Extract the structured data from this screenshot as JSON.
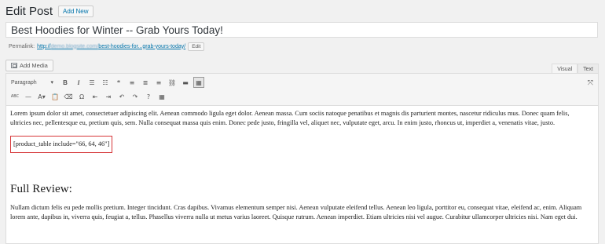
{
  "header": {
    "title": "Edit Post",
    "add_new_label": "Add New"
  },
  "post_title": {
    "value": "Best Hoodies for Winter -- Grab Yours Today!",
    "placeholder": "Enter title here"
  },
  "permalink": {
    "label": "Permalink:",
    "domain_prefix": "http://",
    "domain_blurred": "demo.blogsite.com/",
    "slug": "best-hoodies-for...grab-yours-today/",
    "edit_label": "Edit"
  },
  "media": {
    "add_media_label": "Add Media"
  },
  "tabs": {
    "visual": "Visual",
    "text": "Text"
  },
  "toolbar": {
    "format_value": "Paragraph",
    "row1": [
      {
        "name": "bold-button",
        "glyph": "B",
        "cls": "b"
      },
      {
        "name": "italic-button",
        "glyph": "I",
        "cls": "i"
      },
      {
        "name": "bulleted-list-button",
        "glyph": "☰",
        "cls": ""
      },
      {
        "name": "numbered-list-button",
        "glyph": "☷",
        "cls": ""
      },
      {
        "name": "blockquote-button",
        "glyph": "❝",
        "cls": ""
      },
      {
        "name": "align-left-button",
        "glyph": "≡",
        "cls": ""
      },
      {
        "name": "align-center-button",
        "glyph": "≣",
        "cls": ""
      },
      {
        "name": "align-right-button",
        "glyph": "≡",
        "cls": ""
      },
      {
        "name": "insert-link-button",
        "glyph": "⛓",
        "cls": ""
      },
      {
        "name": "read-more-button",
        "glyph": "▬",
        "cls": ""
      },
      {
        "name": "toolbar-toggle-button",
        "glyph": "▦",
        "cls": "active"
      }
    ],
    "row2": [
      {
        "name": "strikethrough-button",
        "glyph": "ABC",
        "cls": "small"
      },
      {
        "name": "horizontal-line-button",
        "glyph": "—",
        "cls": ""
      },
      {
        "name": "text-color-button",
        "glyph": "A▾",
        "cls": ""
      },
      {
        "name": "paste-as-text-button",
        "glyph": "📋",
        "cls": ""
      },
      {
        "name": "clear-formatting-button",
        "glyph": "⌫",
        "cls": ""
      },
      {
        "name": "special-character-button",
        "glyph": "Ω",
        "cls": ""
      },
      {
        "name": "outdent-button",
        "glyph": "⇤",
        "cls": ""
      },
      {
        "name": "indent-button",
        "glyph": "⇥",
        "cls": ""
      },
      {
        "name": "undo-button",
        "glyph": "↶",
        "cls": ""
      },
      {
        "name": "redo-button",
        "glyph": "↷",
        "cls": ""
      },
      {
        "name": "help-button",
        "glyph": "?",
        "cls": ""
      },
      {
        "name": "table-button",
        "glyph": "▦",
        "cls": ""
      }
    ]
  },
  "content": {
    "paragraph1": "Lorem ipsum dolor sit amet, consectetuer adipiscing elit. Aenean commodo ligula eget dolor. Aenean massa. Cum sociis natoque penatibus et magnis dis parturient montes, nascetur ridiculus mus. Donec quam felis, ultricies nec, pellentesque eu, pretium quis, sem. Nulla consequat massa quis enim. Donec pede justo, fringilla vel, aliquet nec, vulputate eget, arcu. In enim justo, rhoncus ut, imperdiet a, venenatis vitae, justo.",
    "shortcode": "[product_table include=\"66, 64, 46\"]",
    "heading": "Full Review:",
    "paragraph2": "Nullam dictum felis eu pede mollis pretium. Integer tincidunt. Cras dapibus. Vivamus elementum semper nisi. Aenean vulputate eleifend tellus. Aenean leo ligula, porttitor eu, consequat vitae, eleifend ac, enim. Aliquam lorem ante, dapibus in, viverra quis, feugiat a, tellus. Phasellus viverra nulla ut metus varius laoreet. Quisque rutrum. Aenean imperdiet. Etiam ultricies nisi vel augue. Curabitur ullamcorper ultricies nisi. Nam eget dui."
  }
}
